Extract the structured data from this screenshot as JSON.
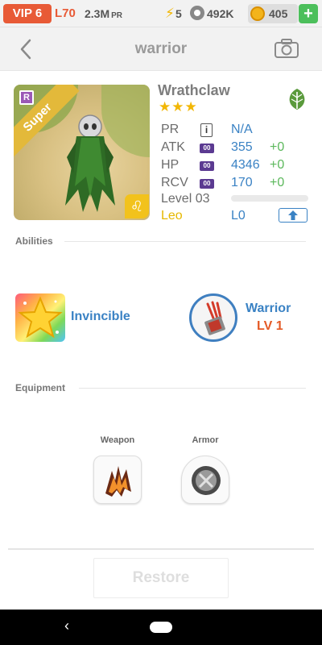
{
  "statusbar": {
    "vip": "VIP 6",
    "level": "L70",
    "power": "2.3M",
    "power_unit": "PR",
    "energy": "5",
    "paw_points": "492K",
    "coins": "405",
    "plus": "+"
  },
  "header": {
    "title": "warrior"
  },
  "hero": {
    "rank_badge": "Super",
    "rarity_letter": "R",
    "name": "Wrathclaw",
    "stars": "★★★",
    "zodiac_symbol": "♌",
    "stats": {
      "pr_label": "PR",
      "pr_info": "i",
      "pr_value": "N/A",
      "atk_label": "ATK",
      "atk_value": "355",
      "atk_bonus": "+0",
      "hp_label": "HP",
      "hp_value": "4346",
      "hp_bonus": "+0",
      "rcv_label": "RCV",
      "rcv_value": "170",
      "rcv_bonus": "+0",
      "stat_badge": "00",
      "level_label": "Level 03",
      "zodiac_label": "Leo",
      "zodiac_level": "L0"
    },
    "element_color": "#5a9a3c",
    "zodiac_color": "#f2c21c"
  },
  "abilities": {
    "section_title": "Abilities",
    "passive_name": "Invincible",
    "skill_name": "Warrior",
    "skill_level": "LV 1"
  },
  "equipment": {
    "section_title": "Equipment",
    "weapon_label": "Weapon",
    "armor_label": "Armor"
  },
  "actions": {
    "restore_label": "Restore"
  },
  "navbar": {
    "back_glyph": "‹"
  },
  "colors": {
    "accent_blue": "#3a82c4",
    "accent_orange": "#e85a36",
    "bonus_green": "#5cb85c"
  }
}
